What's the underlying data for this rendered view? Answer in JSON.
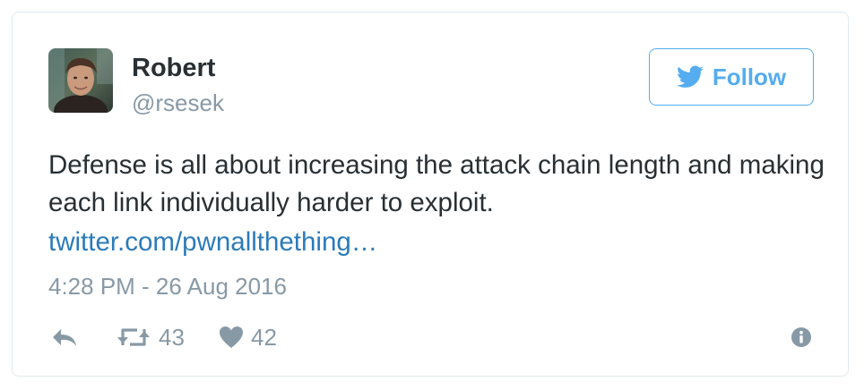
{
  "author": {
    "name": "Robert",
    "handle": "@rsesek"
  },
  "follow_button": {
    "label": "Follow",
    "icon": "twitter-bird-icon"
  },
  "tweet": {
    "text": "Defense is all about increasing the attack chain length and making each link individually harder to exploit.",
    "link": "twitter.com/pwnallthething…",
    "timestamp": "4:28 PM - 26 Aug 2016"
  },
  "actions": {
    "reply_icon": "reply-icon",
    "retweet_icon": "retweet-icon",
    "retweet_count": "43",
    "like_icon": "heart-icon",
    "like_count": "42",
    "info_icon": "info-icon"
  },
  "colors": {
    "text": "#292f33",
    "muted": "#8899a6",
    "accent": "#55acee",
    "link": "#2b7bb9",
    "border": "#e1e8ed"
  }
}
